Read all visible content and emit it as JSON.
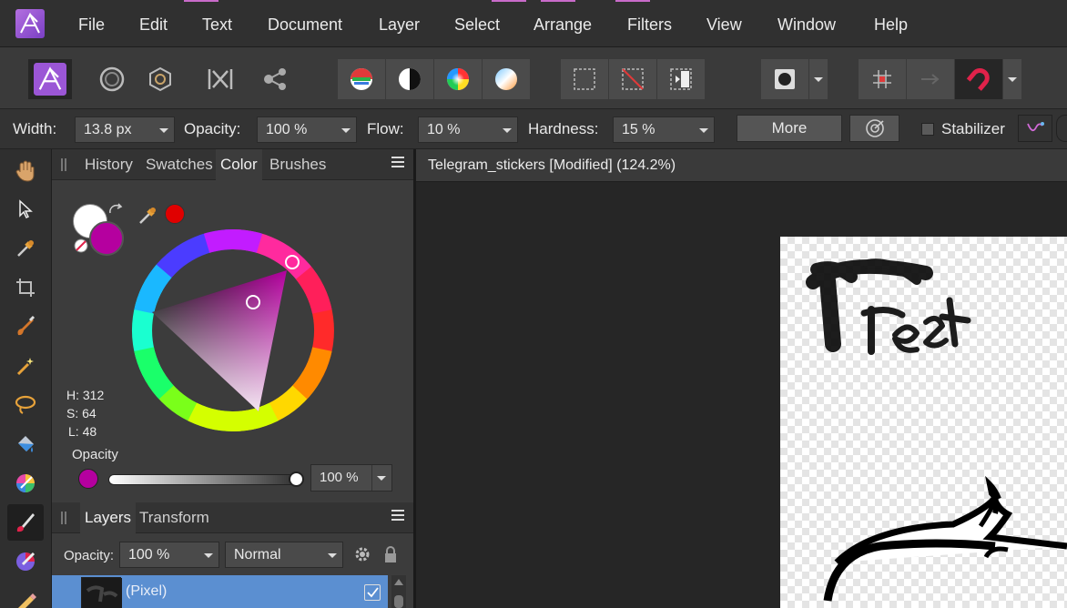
{
  "menu": {
    "items": [
      "File",
      "Edit",
      "Text",
      "Document",
      "Layer",
      "Select",
      "Arrange",
      "Filters",
      "View",
      "Window",
      "Help"
    ]
  },
  "context_bar": {
    "width_label": "Width:",
    "width_value": "13.8 px",
    "opacity_label": "Opacity:",
    "opacity_value": "100 %",
    "flow_label": "Flow:",
    "flow_value": "10 %",
    "hardness_label": "Hardness:",
    "hardness_value": "15 %",
    "more_label": "More",
    "stabilizer_label": "Stabilizer"
  },
  "color_panel": {
    "tabs": [
      "History",
      "Swatches",
      "Color",
      "Brushes"
    ],
    "selected_tab": "Color",
    "h": "H: 312",
    "s": "S: 64",
    "l": "L: 48",
    "opacity_label": "Opacity",
    "opacity_value": "100 %",
    "primary_color": "#ffffff",
    "secondary_color": "#b5009f",
    "picker_color": "#e00000"
  },
  "layers_panel": {
    "tabs": [
      "Layers",
      "Transform"
    ],
    "selected_tab": "Layers",
    "opacity_label": "Opacity:",
    "opacity_value": "100 %",
    "blend_mode": "Normal",
    "layer_name": "(Pixel)"
  },
  "document": {
    "title": "Telegram_stickers [Modified] (124.2%)"
  },
  "colors": {
    "accent": "#5b8fd1",
    "panel_bg": "#3c3c3c"
  }
}
